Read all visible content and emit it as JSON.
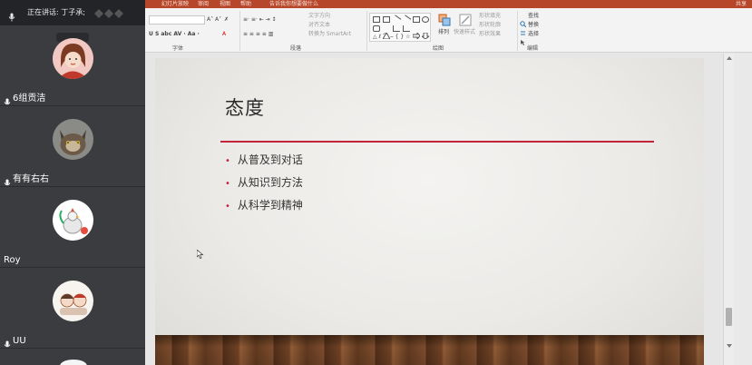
{
  "ribbon": {
    "tabs": [
      "幻灯片放映",
      "审阅",
      "视图",
      "帮助"
    ],
    "tell_me": "告诉我你想要做什么",
    "share": "共享",
    "groups": {
      "font": "字体",
      "paragraph": "段落",
      "drawing": "绘图",
      "editing": "编辑"
    },
    "paragraph_items": {
      "text_direction": "文字方向",
      "align_text": "对齐文本",
      "smartart": "转换为 SmartArt"
    },
    "drawing_items": {
      "arrange": "排列",
      "quick_styles": "快速样式",
      "shape_fill": "形状填充",
      "shape_outline": "形状轮廓",
      "shape_effects": "形状效果"
    },
    "editing_items": {
      "find": "查找",
      "replace": "替换",
      "select": "选择"
    }
  },
  "panel": {
    "speaking": "正在讲话: 丁子承;",
    "participants": [
      {
        "name": "6组贡洁"
      },
      {
        "name": "有有右右"
      },
      {
        "name": "Roy"
      },
      {
        "name": "UU"
      }
    ]
  },
  "slide": {
    "title": "态度",
    "bullets": [
      "从普及到对话",
      "从知识到方法",
      "从科学到精神"
    ]
  },
  "colors": {
    "ribbon_tab": "#b7472a",
    "accent_rule": "#c4243a",
    "panel_bg": "#2b2c30"
  }
}
